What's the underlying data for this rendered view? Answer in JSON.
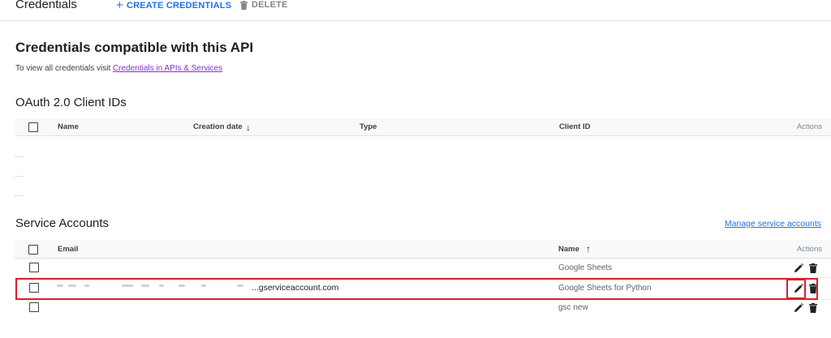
{
  "header": {
    "title": "Credentials",
    "create_label": "CREATE CREDENTIALS",
    "delete_label": "DELETE"
  },
  "api_section": {
    "heading": "Credentials compatible with this API",
    "intro_text": "To view all credentials visit ",
    "intro_link": "Credentials in APIs & Services"
  },
  "oauth": {
    "heading": "OAuth 2.0 Client IDs",
    "columns": {
      "name": "Name",
      "creation_date": "Creation date",
      "type": "Type",
      "client_id": "Client ID",
      "actions": "Actions"
    },
    "rows": []
  },
  "service_accounts": {
    "heading": "Service Accounts",
    "manage_link": "Manage service accounts",
    "columns": {
      "email": "Email",
      "name": "Name",
      "actions": "Actions"
    },
    "rows": [
      {
        "email": "",
        "name": "Google Sheets"
      },
      {
        "email": "...gserviceaccount.com",
        "name": "Google Sheets for Python",
        "highlighted": true
      },
      {
        "email": "",
        "name": "gsc new"
      }
    ]
  },
  "colors": {
    "accent": "#1a73e8",
    "visited_link": "#8430ce",
    "highlight": "#d9202b"
  }
}
